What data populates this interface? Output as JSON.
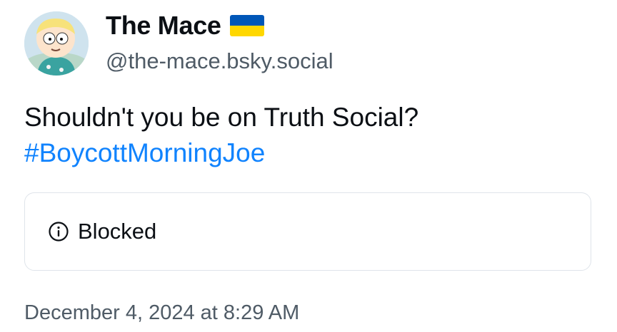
{
  "author": {
    "display_name": "The Mace",
    "flag_icon": "ukraine-flag-icon",
    "handle": "@the-mace.bsky.social",
    "avatar_icon": "cartoon-character-avatar"
  },
  "post": {
    "text": "Shouldn't you be on Truth Social?",
    "hashtag": "#BoycottMorningJoe"
  },
  "quote_card": {
    "icon": "info-circle-icon",
    "label": "Blocked"
  },
  "timestamp": "December 4, 2024 at 8:29 AM",
  "colors": {
    "hashtag": "#1083fe",
    "secondary_text": "#4f5b66",
    "card_border": "#dfe4ea",
    "flag_blue": "#0057b8",
    "flag_yellow": "#ffd700"
  }
}
